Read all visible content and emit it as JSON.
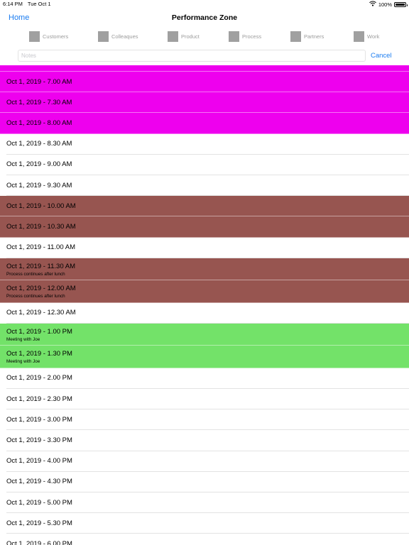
{
  "status_bar": {
    "time": "6:14 PM",
    "date": "Tue Oct 1",
    "battery_text": "100%",
    "battery_level": 1.0,
    "wifi_icon": "wifi-icon",
    "battery_icon": "battery-icon"
  },
  "nav": {
    "home_label": "Home",
    "title": "Performance Zone"
  },
  "filters": [
    {
      "label": "Customers"
    },
    {
      "label": "Colleaques"
    },
    {
      "label": "Product"
    },
    {
      "label": "Process"
    },
    {
      "label": "Partners"
    },
    {
      "label": "Work"
    }
  ],
  "notes": {
    "placeholder": "Notes",
    "value": ""
  },
  "cancel_label": "Cancel",
  "colors": {
    "accent": "#1a7cf0",
    "magenta": "#ee00ee",
    "brown": "#975550",
    "green": "#73e269",
    "filter_box": "#a0a0a0"
  },
  "slots": [
    {
      "title": "",
      "subtitle": "",
      "color": "magenta"
    },
    {
      "title": "Oct 1, 2019 - 7.00 AM",
      "subtitle": "",
      "color": "magenta"
    },
    {
      "title": "Oct 1, 2019 - 7.30 AM",
      "subtitle": "",
      "color": "magenta"
    },
    {
      "title": "Oct 1, 2019 - 8.00 AM",
      "subtitle": "",
      "color": "magenta"
    },
    {
      "title": "Oct 1, 2019 - 8.30 AM",
      "subtitle": "",
      "color": ""
    },
    {
      "title": "Oct 1, 2019 - 9.00 AM",
      "subtitle": "",
      "color": ""
    },
    {
      "title": "Oct 1, 2019 - 9.30 AM",
      "subtitle": "",
      "color": ""
    },
    {
      "title": "Oct 1, 2019 - 10.00 AM",
      "subtitle": "",
      "color": "brown"
    },
    {
      "title": "Oct 1, 2019 - 10.30 AM",
      "subtitle": "",
      "color": "brown"
    },
    {
      "title": "Oct 1, 2019 - 11.00 AM",
      "subtitle": "",
      "color": ""
    },
    {
      "title": "Oct 1, 2019 - 11.30 AM",
      "subtitle": "Process continues after lunch",
      "color": "brown"
    },
    {
      "title": "Oct 1, 2019 - 12.00 AM",
      "subtitle": "Process continues after lunch",
      "color": "brown"
    },
    {
      "title": "Oct 1, 2019 - 12.30 AM",
      "subtitle": "",
      "color": ""
    },
    {
      "title": "Oct 1, 2019 - 1.00 PM",
      "subtitle": "Meeting with Joe",
      "color": "green"
    },
    {
      "title": "Oct 1, 2019 - 1.30 PM",
      "subtitle": "Meeting with Joe",
      "color": "green"
    },
    {
      "title": "Oct 1, 2019 - 2.00 PM",
      "subtitle": "",
      "color": ""
    },
    {
      "title": "Oct 1, 2019 - 2.30 PM",
      "subtitle": "",
      "color": ""
    },
    {
      "title": "Oct 1, 2019 - 3.00 PM",
      "subtitle": "",
      "color": ""
    },
    {
      "title": "Oct 1, 2019 - 3.30 PM",
      "subtitle": "",
      "color": ""
    },
    {
      "title": "Oct 1, 2019 - 4.00 PM",
      "subtitle": "",
      "color": ""
    },
    {
      "title": "Oct 1, 2019 - 4.30 PM",
      "subtitle": "",
      "color": ""
    },
    {
      "title": "Oct 1, 2019 - 5.00 PM",
      "subtitle": "",
      "color": ""
    },
    {
      "title": "Oct 1, 2019 - 5.30 PM",
      "subtitle": "",
      "color": ""
    },
    {
      "title": "Oct 1, 2019 - 6.00 PM",
      "subtitle": "",
      "color": ""
    }
  ]
}
